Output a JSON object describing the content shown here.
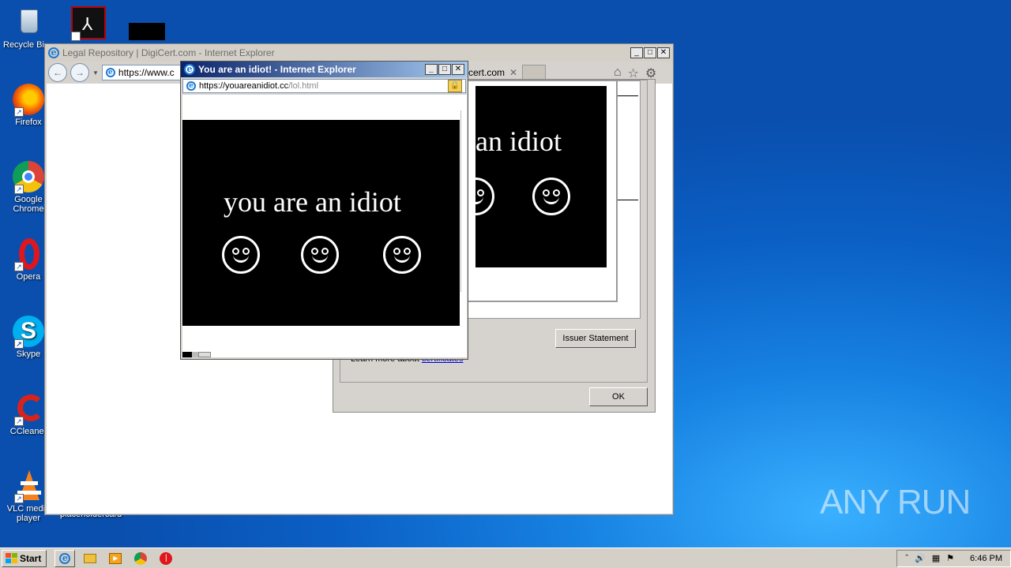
{
  "desktop": {
    "icons": [
      {
        "name": "recycle-bin-icon",
        "label": "Recycle Bin"
      },
      {
        "name": "firefox-icon",
        "label": "Firefox"
      },
      {
        "name": "google-chrome-icon",
        "label": "Google Chrome"
      },
      {
        "name": "opera-icon",
        "label": "Opera"
      },
      {
        "name": "skype-icon",
        "label": "Skype"
      },
      {
        "name": "ccleaner-icon",
        "label": "CCleaner"
      },
      {
        "name": "vlc-icon",
        "label": "VLC media player"
      }
    ],
    "partial_label": "placeholdercard"
  },
  "main_window": {
    "title": "Legal Repository | DigiCert.com - Internet Explorer",
    "url": "https://www.c",
    "tab_label": "cert.com"
  },
  "cert_dialog": {
    "banner_text": "an idiot",
    "issuer_button": "Issuer Statement",
    "learn_more": "Learn more about",
    "learn_link": "certificates",
    "ok_button": "OK"
  },
  "popup": {
    "title": "You are an idiot! - Internet Explorer",
    "url_main": "https://youareanidiot.cc",
    "url_path": "/lol.html",
    "banner_text": "you are an idiot"
  },
  "taskbar": {
    "start_label": "Start",
    "clock": "6:46 PM"
  },
  "watermark": "ANY RUN",
  "colors": {
    "titlebar_active": "#0a246a",
    "titlebar_active_end": "#a6caf0",
    "titlebar_inactive": "#d4d0c8",
    "desktop": "#1782e2"
  }
}
